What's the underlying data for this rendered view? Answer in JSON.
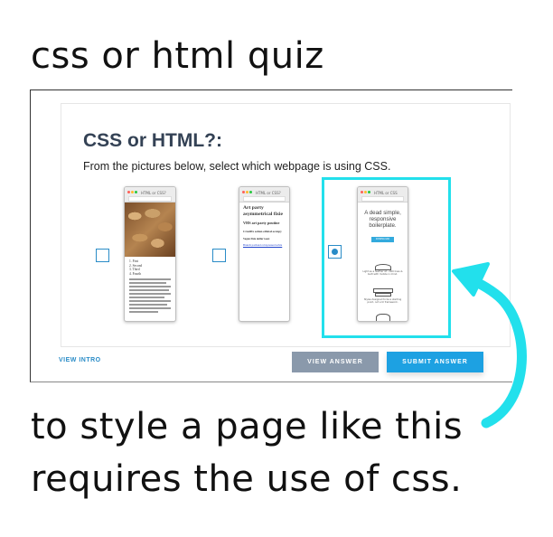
{
  "captions": {
    "top": "css or html quiz",
    "bottom_line1": "to style a page like this",
    "bottom_line2": "requires the use of css."
  },
  "quiz": {
    "title": "CSS or HTML?:",
    "instruction": "From the pictures below, select which webpage is using CSS.",
    "view_intro": "VIEW INTRO",
    "view_answer": "VIEW ANSWER",
    "submit_answer": "SUBMIT ANSWER"
  },
  "options": [
    {
      "tab_label": "HTML or CSS?",
      "list_items": [
        "1. First",
        "2. Second",
        "3. Third",
        "4. Fourth"
      ],
      "selected": false
    },
    {
      "tab_label": "HTML or CSS?",
      "heading": "Art party asymmetrical fixie",
      "subheading": "VHS art party poutine",
      "line3": "Crucifix seitan ethical occupy",
      "line4": "Vegan fixie dollar toast",
      "link_text": "Brunch portland cold-pressed salvia",
      "selected": false
    },
    {
      "tab_label": "HTML or CSS",
      "hero": "A dead simple, responsive boilerplate.",
      "cta": "DOWNLOAD",
      "feature1": "Light as a feather at ~400 lines & built with mobile in mind.",
      "feature2": "Styles designed to be a starting point, not a UI framework.",
      "selected": true
    }
  ],
  "colors": {
    "heading": "#344255",
    "accent_blue": "#2a8cc7",
    "view_answer_bg": "#8a99ab",
    "submit_bg": "#1da1e2",
    "highlight": "#22e0ec",
    "arrow": "#22e0ec"
  }
}
